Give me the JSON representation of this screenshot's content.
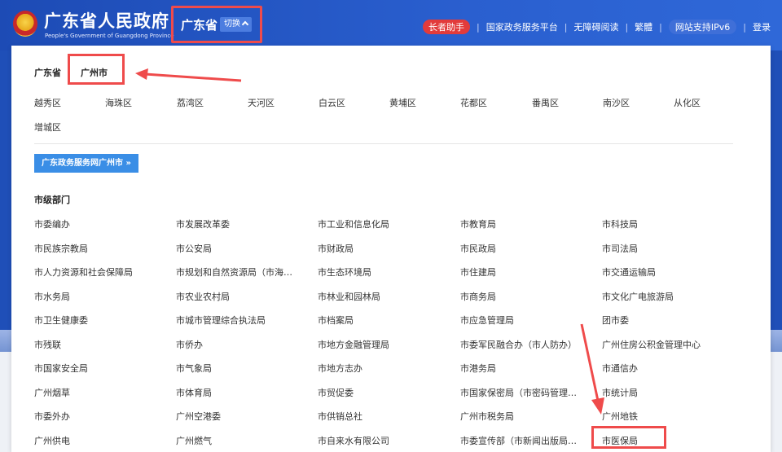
{
  "header": {
    "site_name": "广东省人民政府",
    "site_sub": "People's Government of Guangdong Province",
    "province": "广东省",
    "switch_label": "切换",
    "nav": {
      "elder": "长者助手",
      "gov_service": "国家政务服务平台",
      "accessible": "无障碍阅读",
      "traditional": "繁體",
      "ipv6": "网站支持IPv6",
      "login": "登录"
    }
  },
  "panel": {
    "crumb_province": "广东省",
    "crumb_city": "广州市",
    "districts": [
      "越秀区",
      "海珠区",
      "荔湾区",
      "天河区",
      "白云区",
      "黄埔区",
      "花都区",
      "番禺区",
      "南沙区",
      "从化区",
      "增城区"
    ],
    "service_link": "广东政务服务网广州市 »",
    "section_title": "市级部门",
    "departments": [
      [
        "市委编办",
        "市发展改革委",
        "市工业和信息化局",
        "市教育局",
        "市科技局"
      ],
      [
        "市民族宗教局",
        "市公安局",
        "市财政局",
        "市民政局",
        "市司法局"
      ],
      [
        "市人力资源和社会保障局",
        "市规划和自然资源局（市海…",
        "市生态环境局",
        "市住建局",
        "市交通运输局"
      ],
      [
        "市水务局",
        "市农业农村局",
        "市林业和园林局",
        "市商务局",
        "市文化广电旅游局"
      ],
      [
        "市卫生健康委",
        "市城市管理综合执法局",
        "市档案局",
        "市应急管理局",
        "团市委"
      ],
      [
        "市残联",
        "市侨办",
        "市地方金融管理局",
        "市委军民融合办（市人防办）",
        "广州住房公积金管理中心"
      ],
      [
        "市国家安全局",
        "市气象局",
        "市地方志办",
        "市港务局",
        "市通信办"
      ],
      [
        "广州烟草",
        "市体育局",
        "市贸促委",
        "市国家保密局（市密码管理…",
        "市统计局"
      ],
      [
        "市委外办",
        "广州空港委",
        "市供销总社",
        "广州市税务局",
        "广州地铁"
      ],
      [
        "广州供电",
        "广州燃气",
        "市自来水有限公司",
        "市委宣传部（市新闻出版局…",
        "市医保局"
      ]
    ]
  }
}
